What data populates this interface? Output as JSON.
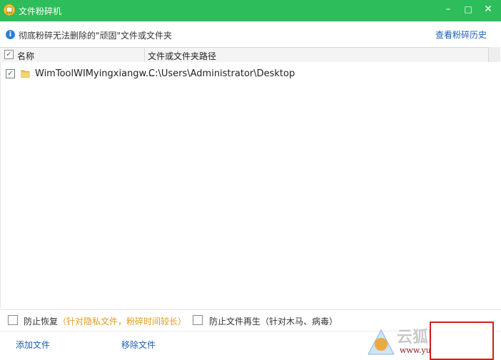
{
  "window": {
    "title": "文件粉碎机",
    "minimize": "–",
    "maximize": "□",
    "close": "✕"
  },
  "info": {
    "text": "彻底粉碎无法删除的\"顽固\"文件或文件夹",
    "history_link": "查看粉碎历史"
  },
  "table": {
    "col_name": "名称",
    "col_path": "文件或文件夹路径",
    "rows": [
      {
        "name": "WimToolWIMyingxiangw...",
        "path": "C:\\Users\\Administrator\\Desktop",
        "checked": true
      }
    ]
  },
  "options": {
    "prevent_recovery": "防止恢复",
    "prevent_recovery_note": "（针对隐私文件，粉碎时间较长）",
    "prevent_regen": "防止文件再生（针对木马、病毒）"
  },
  "bottom": {
    "add_file": "添加文件",
    "remove_file": "移除文件"
  },
  "watermark": {
    "main": "云狐网",
    "url": "www.yunhu.net"
  },
  "colors": {
    "titlebar": "#2dbd5a",
    "link": "#1a5fb4",
    "warn": "#e39a1b",
    "shred_border": "#d01e1e"
  }
}
